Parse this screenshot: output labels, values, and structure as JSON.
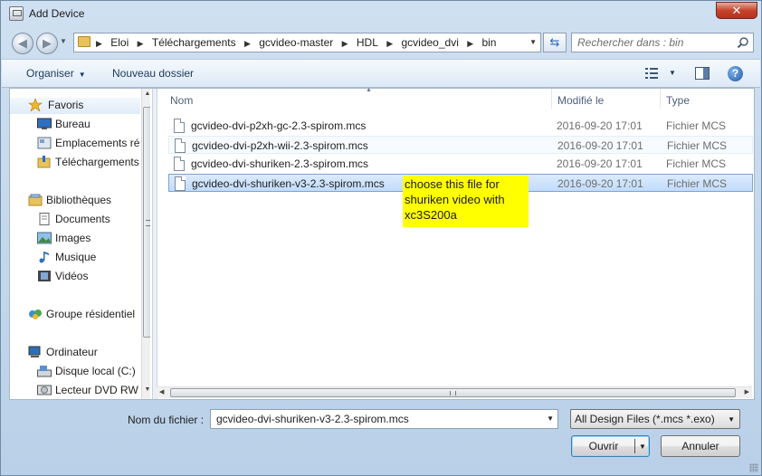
{
  "window": {
    "title": "Add Device",
    "close_glyph": "✕"
  },
  "address_bar": {
    "crumbs": [
      "Eloi",
      "Téléchargements",
      "gcvideo-master",
      "HDL",
      "gcvideo_dvi",
      "bin"
    ]
  },
  "search": {
    "placeholder": "Rechercher dans : bin"
  },
  "toolbar": {
    "organize_label": "Organiser",
    "new_folder_label": "Nouveau dossier"
  },
  "nav": {
    "items": [
      {
        "label": "Favoris",
        "icon": "star-icon"
      },
      {
        "label": "Bureau",
        "icon": "desktop-icon"
      },
      {
        "label": "Emplacements ré",
        "icon": "places-icon"
      },
      {
        "label": "Téléchargements",
        "icon": "downloads-icon"
      },
      {
        "label": "Bibliothèques",
        "icon": "library-icon"
      },
      {
        "label": "Documents",
        "icon": "documents-icon"
      },
      {
        "label": "Images",
        "icon": "images-icon"
      },
      {
        "label": "Musique",
        "icon": "music-icon"
      },
      {
        "label": "Vidéos",
        "icon": "videos-icon"
      },
      {
        "label": "Groupe résidentiel",
        "icon": "homegroup-icon"
      },
      {
        "label": "Ordinateur",
        "icon": "computer-icon"
      },
      {
        "label": "Disque local (C:)",
        "icon": "disk-icon"
      },
      {
        "label": "Lecteur DVD RW",
        "icon": "dvd-icon"
      }
    ]
  },
  "columns": {
    "name": "Nom",
    "modified": "Modifié le",
    "type": "Type"
  },
  "files": [
    {
      "name": "gcvideo-dvi-p2xh-gc-2.3-spirom.mcs",
      "date": "2016-09-20 17:01",
      "type": "Fichier MCS"
    },
    {
      "name": "gcvideo-dvi-p2xh-wii-2.3-spirom.mcs",
      "date": "2016-09-20 17:01",
      "type": "Fichier MCS"
    },
    {
      "name": "gcvideo-dvi-shuriken-2.3-spirom.mcs",
      "date": "2016-09-20 17:01",
      "type": "Fichier MCS"
    },
    {
      "name": "gcvideo-dvi-shuriken-v3-2.3-spirom.mcs",
      "date": "2016-09-20 17:01",
      "type": "Fichier MCS"
    }
  ],
  "annotation": {
    "text": "choose this file for shuriken video with xc3S200a"
  },
  "footer": {
    "filename_label": "Nom du fichier :",
    "filename_value": "gcvideo-dvi-shuriken-v3-2.3-spirom.mcs",
    "filter_value": "All Design Files (*.mcs *.exo)",
    "open_label": "Ouvrir",
    "cancel_label": "Annuler"
  },
  "colors": {
    "selection": "#c1dcfc",
    "annotation_bg": "#ffff00",
    "close_button": "#c7442d"
  }
}
